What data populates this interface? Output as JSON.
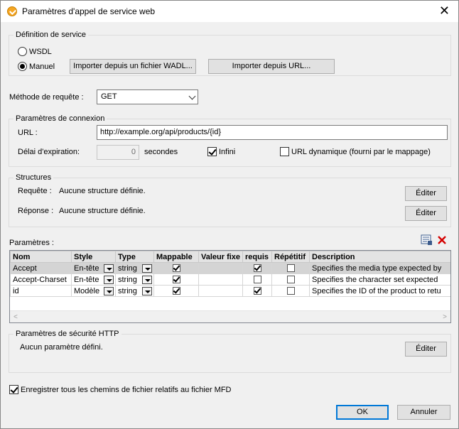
{
  "window": {
    "title": "Paramètres d'appel de service web"
  },
  "service": {
    "legend": "Définition de service",
    "wsdl_label": "WSDL",
    "manual_label": "Manuel",
    "import_wadl_btn": "Importer depuis un fichier WADL...",
    "import_url_btn": "Importer depuis URL..."
  },
  "method": {
    "label": "Méthode de requête :",
    "value": "GET"
  },
  "connection": {
    "legend": "Paramètres de connexion",
    "url_label": "URL :",
    "url_value": "http://example.org/api/products/{id}",
    "timeout_label": "Délai d'expiration:",
    "timeout_value": "0",
    "timeout_unit": "secondes",
    "infinite_label": "Infini",
    "dynamic_url_label": "URL dynamique (fourni par le mappage)"
  },
  "structures": {
    "legend": "Structures",
    "request_label": "Requête :",
    "request_value": "Aucune structure définie.",
    "response_label": "Réponse :",
    "response_value": "Aucune structure définie.",
    "edit_btn": "Éditer"
  },
  "parameters": {
    "label": "Paramètres :",
    "columns": [
      "Nom",
      "Style",
      "Type",
      "Mappable",
      "Valeur fixe",
      "requis",
      "Répétitif",
      "Description"
    ],
    "rows": [
      {
        "name": "Accept",
        "style": "En-tête",
        "type": "string",
        "mappable": true,
        "fixed": "",
        "required": true,
        "repeating": false,
        "description": "Specifies the media type expected by"
      },
      {
        "name": "Accept-Charset",
        "style": "En-tête",
        "type": "string",
        "mappable": true,
        "fixed": "",
        "required": false,
        "repeating": false,
        "description": "Specifies the character set expected"
      },
      {
        "name": "id",
        "style": "Modèle",
        "type": "string",
        "mappable": true,
        "fixed": "",
        "required": true,
        "repeating": false,
        "description": "Specifies the ID of the product to retu"
      }
    ]
  },
  "security": {
    "legend": "Paramètres de sécurité HTTP",
    "value": "Aucun paramètre défini.",
    "edit_btn": "Éditer"
  },
  "footer": {
    "save_relative_label": "Enregistrer tous les chemins de fichier relatifs au fichier MFD",
    "ok_btn": "OK",
    "cancel_btn": "Annuler"
  }
}
